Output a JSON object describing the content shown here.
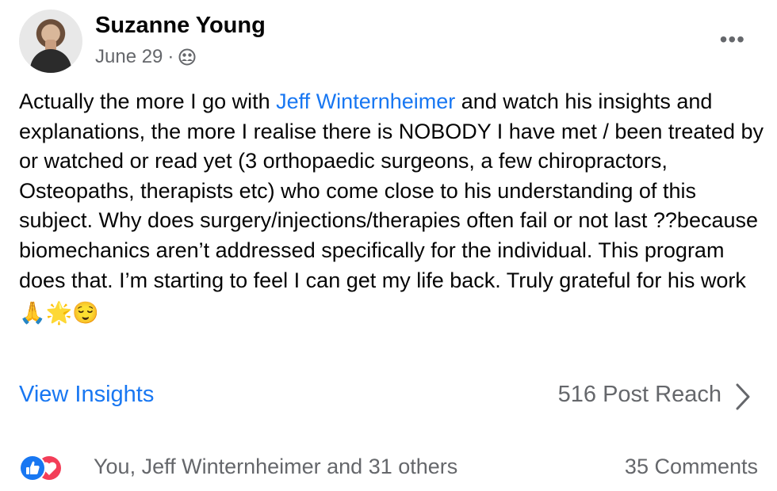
{
  "post": {
    "author": "Suzanne Young",
    "date": "June 29",
    "separator": "·",
    "audience_icon": "friends-icon",
    "text_before_mention": "Actually the more I go with ",
    "mention": "Jeff Winternheimer",
    "text_after_mention": " and watch his insights and explanations, the more I realise there is NOBODY I have met / been treated by or watched or read yet (3 orthopaedic surgeons, a few chiropractors, Osteopaths, therapists etc) who come close to his understanding of this subject. Why does surgery/injections/therapies often fail or not last ??because biomechanics aren’t addressed specifically for the individual. This program does that. I’m starting to feel I can get my life back. Truly grateful for his work ",
    "emojis": [
      "🙏",
      "🌟",
      "😌"
    ]
  },
  "insights": {
    "view_label": "View Insights",
    "reach_label": "516 Post Reach"
  },
  "engagement": {
    "reactions": [
      "like",
      "love"
    ],
    "reactors_text": "You, Jeff Winternheimer and 31 others",
    "comments_text": "35 Comments"
  },
  "colors": {
    "link_blue": "#1877f2",
    "secondary_text": "#65676b",
    "love_red": "#f33e58"
  }
}
